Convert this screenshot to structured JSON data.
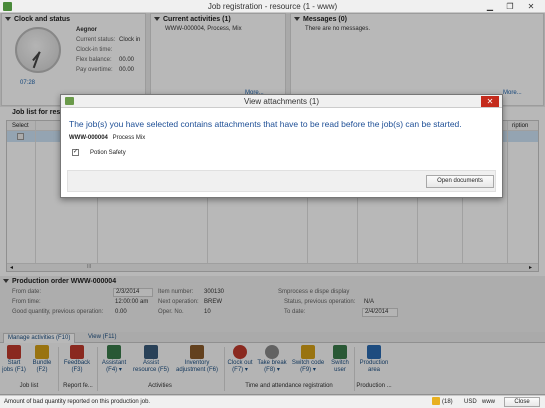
{
  "window": {
    "title": "Job registration - resource (1 - www)",
    "minimize": "▁",
    "maximize": "❐",
    "close": "✕"
  },
  "clock_status": {
    "title": "Clock and status",
    "time": "07:28",
    "name": "Aegnor",
    "fields": [
      {
        "label": "Current status:",
        "value": "Clock in"
      },
      {
        "label": "Clock-in time:",
        "value": ""
      },
      {
        "label": "Flex balance:",
        "value": "00.00"
      },
      {
        "label": "Pay overtime:",
        "value": "00.00"
      }
    ]
  },
  "current_activities": {
    "title": "Current activities (1)",
    "item": "WWW-000004, Process, Mix",
    "more": "More..."
  },
  "messages": {
    "title": "Messages (0)",
    "text": "There are no messages.",
    "more": "More..."
  },
  "job_list": {
    "title": "Job list for res",
    "col_select": "Select",
    "col_description": "ription",
    "hscroll": "III"
  },
  "dialog": {
    "title": "View attachments (1)",
    "close": "✕",
    "message": "The job(s) you have selected contains attachments that have to be read before the job(s) can be started.",
    "job_id": "WWW-000004",
    "job_detail": "Process  Mix",
    "attachment": "Potion Safety",
    "open_button": "Open documents"
  },
  "production_order": {
    "title": "Production order WWW-000004",
    "from_date_label": "From date:",
    "from_date": "2/3/2014",
    "from_time_label": "From time:",
    "from_time": "12:00:00 am",
    "good_qty_label": "Good quantity, previous operation:",
    "good_qty": "0.00",
    "item_label": "Item number:",
    "item": "300130",
    "next_op_label": "Next operation:",
    "next_op": "BREW",
    "oper_no_label": "Oper. No.",
    "oper_no": "10",
    "overlap_text": "Smprocess e dispe display",
    "status_prev_label": "Status, previous operation:",
    "status_prev": "N/A",
    "to_date_label": "To date:",
    "to_date": "2/4/2014"
  },
  "ribbon": {
    "tabs": [
      "Manage activities (F10)",
      "View (F11)"
    ],
    "buttons": [
      {
        "label": "Start jobs (F1)",
        "color": "#c0392b"
      },
      {
        "label": "Bundle (F2)",
        "color": "#d4a017"
      },
      {
        "label": "Feedback (F3)",
        "color": "#c0392b"
      },
      {
        "label": "Assistant (F4) ▾",
        "color": "#3a7a4a"
      },
      {
        "label": "Assist resource (F5)",
        "color": "#3a5a7a"
      },
      {
        "label": "Inventory adjustment (F6)",
        "color": "#8a5a2a"
      },
      {
        "label": "Clock out (F7) ▾",
        "color": "#c0392b"
      },
      {
        "label": "Take break (F8) ▾",
        "color": "#888888"
      },
      {
        "label": "Switch code (F9) ▾",
        "color": "#d4a017"
      },
      {
        "label": "Switch user",
        "color": "#3a7a4a"
      },
      {
        "label": "Production area",
        "color": "#2a6ab0"
      }
    ],
    "groups": [
      "Job list",
      "Report fe...",
      "Activities",
      "Time and attendance registration",
      "Production ..."
    ]
  },
  "statusbar": {
    "text": "Amount of bad quantity reported on this production job.",
    "notif": "(18)",
    "currency": "USD",
    "company": "www",
    "close": "Close"
  }
}
